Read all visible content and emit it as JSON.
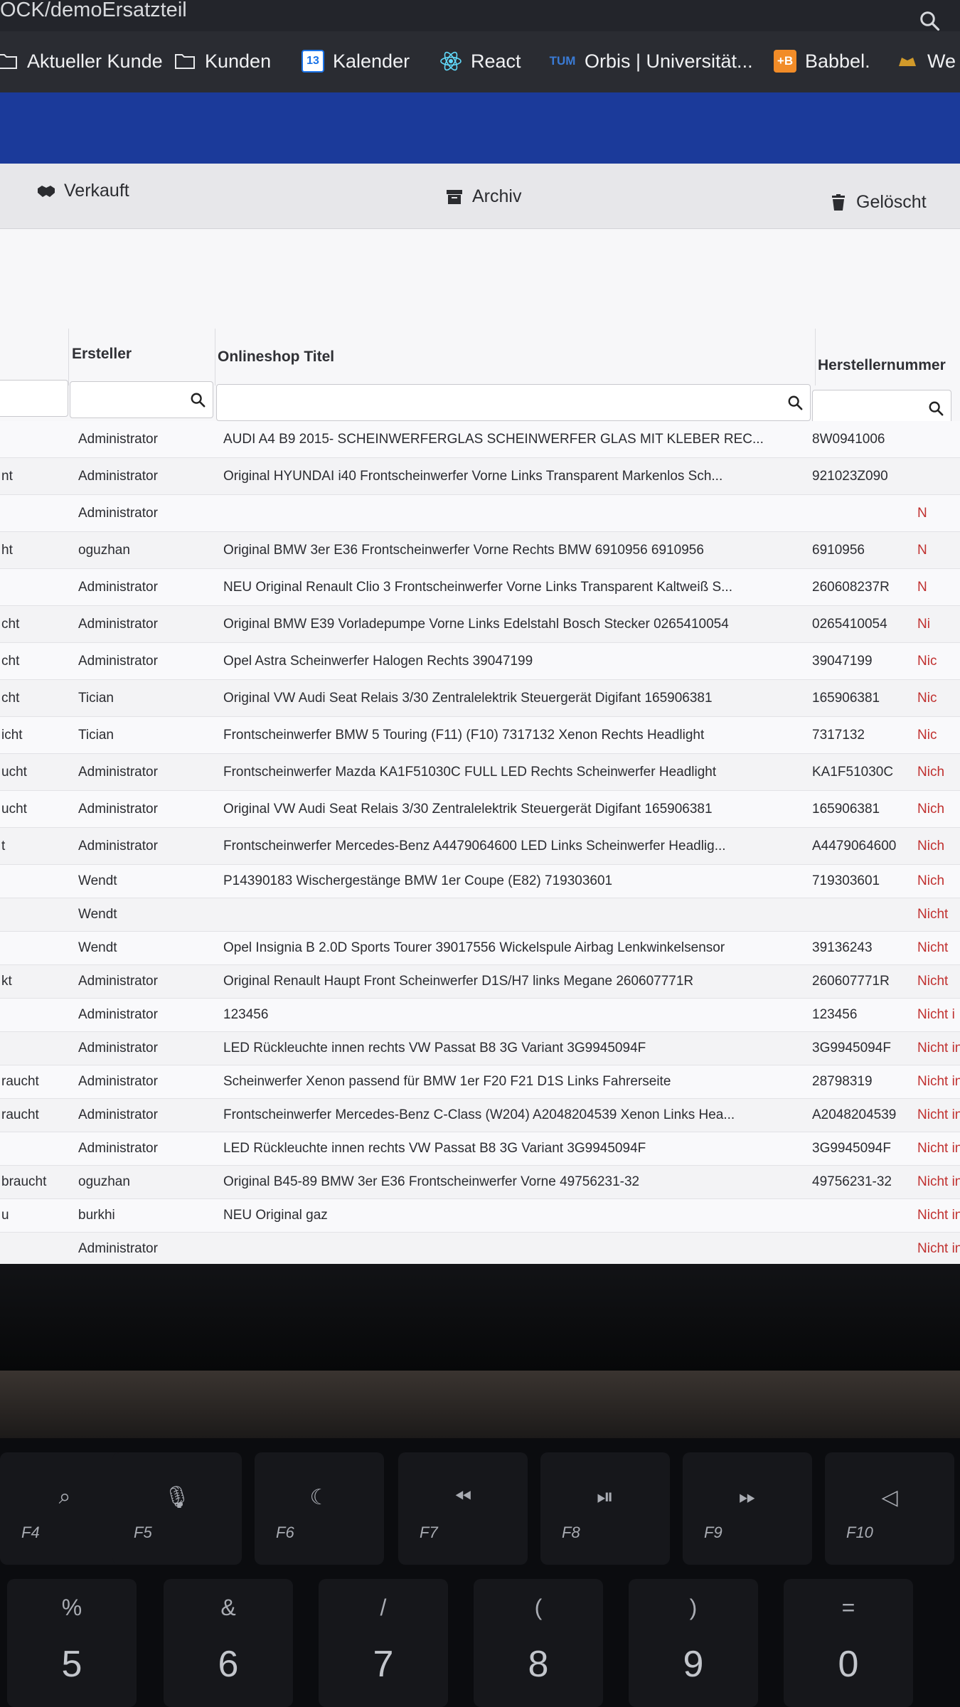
{
  "browser": {
    "url_fragment": "OCK/demoErsatzteil",
    "bookmarks": [
      {
        "label": "Aktueller Kunde",
        "icon": "folder-icon"
      },
      {
        "label": "Kunden",
        "icon": "folder-icon"
      },
      {
        "label": "Kalender",
        "icon": "calendar-icon",
        "icon_text": "13"
      },
      {
        "label": "React",
        "icon": "react-icon"
      },
      {
        "label": "Orbis | Universität...",
        "icon": "tum-icon",
        "icon_text": "TUM"
      },
      {
        "label": "Babbel.",
        "icon": "babbel-icon",
        "icon_text": "+B"
      },
      {
        "label": "We",
        "icon": "hat-icon"
      }
    ]
  },
  "tabs": [
    {
      "label": "Verkauft",
      "icon": "handshake-icon"
    },
    {
      "label": "Archiv",
      "icon": "archive-icon"
    },
    {
      "label": "Gelöscht",
      "icon": "trash-icon"
    }
  ],
  "table": {
    "headers": {
      "creator": "Ersteller",
      "title": "Onlineshop Titel",
      "number": "Herstellernummer"
    },
    "rows": [
      {
        "status": "",
        "creator": "Administrator",
        "title": "AUDI A4 B9 2015- SCHEINWERFERGLAS SCHEINWERFER GLAS MIT KLEBER REC...",
        "number": "8W0941006",
        "shop": ""
      },
      {
        "status": "nt",
        "creator": "Administrator",
        "title": "Original HYUNDAI i40 Frontscheinwerfer Vorne Links Transparent Markenlos Sch...",
        "number": "921023Z090",
        "shop": ""
      },
      {
        "status": "",
        "creator": "Administrator",
        "title": "",
        "number": "",
        "shop": "N"
      },
      {
        "status": "ht",
        "creator": "oguzhan",
        "title": "Original BMW 3er E36 Frontscheinwerfer Vorne Rechts BMW 6910956 6910956",
        "number": "6910956",
        "shop": "N"
      },
      {
        "status": "",
        "creator": "Administrator",
        "title": "NEU Original Renault Clio 3 Frontscheinwerfer Vorne Links Transparent Kaltweiß S...",
        "number": "260608237R",
        "shop": "N"
      },
      {
        "status": "cht",
        "creator": "Administrator",
        "title": "Original BMW E39 Vorladepumpe Vorne Links Edelstahl Bosch Stecker 0265410054",
        "number": "0265410054",
        "shop": "Ni"
      },
      {
        "status": "cht",
        "creator": "Administrator",
        "title": "Opel Astra Scheinwerfer Halogen Rechts 39047199",
        "number": "39047199",
        "shop": "Nic"
      },
      {
        "status": "cht",
        "creator": "Tician",
        "title": "Original VW Audi Seat Relais 3/30 Zentralelektrik Steuergerät Digifant 165906381",
        "number": "165906381",
        "shop": "Nic"
      },
      {
        "status": "icht",
        "creator": "Tician",
        "title": "Frontscheinwerfer BMW 5 Touring (F11) (F10) 7317132 Xenon Rechts Headlight",
        "number": "7317132",
        "shop": "Nic"
      },
      {
        "status": "ucht",
        "creator": "Administrator",
        "title": "Frontscheinwerfer Mazda KA1F51030C FULL LED Rechts Scheinwerfer Headlight",
        "number": "KA1F51030C",
        "shop": "Nich"
      },
      {
        "status": "ucht",
        "creator": "Administrator",
        "title": "Original VW Audi Seat Relais 3/30 Zentralelektrik Steuergerät Digifant 165906381",
        "number": "165906381",
        "shop": "Nich"
      },
      {
        "status": "t",
        "creator": "Administrator",
        "title": "Frontscheinwerfer Mercedes-Benz A4479064600 LED Links Scheinwerfer Headlig...",
        "number": "A4479064600",
        "shop": "Nich"
      },
      {
        "status": "",
        "creator": "Wendt",
        "title": "P14390183 Wischergestänge BMW 1er Coupe (E82) 719303601",
        "number": "719303601",
        "shop": "Nich"
      },
      {
        "status": "",
        "creator": "Wendt",
        "title": "",
        "number": "",
        "shop": "Nicht"
      },
      {
        "status": "",
        "creator": "Wendt",
        "title": "Opel Insignia B 2.0D Sports Tourer 39017556 Wickelspule Airbag Lenkwinkelsensor",
        "number": "39136243",
        "shop": "Nicht"
      },
      {
        "status": "kt",
        "creator": "Administrator",
        "title": "Original Renault Haupt Front Scheinwerfer D1S/H7 links Megane 260607771R",
        "number": "260607771R",
        "shop": "Nicht"
      },
      {
        "status": "",
        "creator": "Administrator",
        "title": "123456",
        "number": "123456",
        "shop": "Nicht i"
      },
      {
        "status": "",
        "creator": "Administrator",
        "title": "LED Rückleuchte innen rechts VW Passat B8 3G Variant 3G9945094F",
        "number": "3G9945094F",
        "shop": "Nicht in"
      },
      {
        "status": "raucht",
        "creator": "Administrator",
        "title": "Scheinwerfer Xenon passend für BMW 1er F20 F21 D1S Links Fahrerseite",
        "number": "28798319",
        "shop": "Nicht in"
      },
      {
        "status": "raucht",
        "creator": "Administrator",
        "title": "Frontscheinwerfer Mercedes-Benz C-Class (W204) A2048204539 Xenon Links Hea...",
        "number": "A2048204539",
        "shop": "Nicht in"
      },
      {
        "status": "",
        "creator": "Administrator",
        "title": "LED Rückleuchte innen rechts VW Passat B8 3G Variant 3G9945094F",
        "number": "3G9945094F",
        "shop": "Nicht in"
      },
      {
        "status": "braucht",
        "creator": "oguzhan",
        "title": "Original B45-89 BMW 3er E36 Frontscheinwerfer Vorne 49756231-32",
        "number": "49756231-32",
        "shop": "Nicht ins"
      },
      {
        "status": "u",
        "creator": "burkhi",
        "title": "NEU Original gaz",
        "number": "",
        "shop": "Nicht ins"
      },
      {
        "status": "",
        "creator": "Administrator",
        "title": "",
        "number": "",
        "shop": "Nicht ins"
      }
    ]
  },
  "keyboard": {
    "function_keys": [
      {
        "label": "F4",
        "glyph": "search-icon"
      },
      {
        "label": "F5",
        "glyph": "mic-icon"
      },
      {
        "label": "F6",
        "glyph": "moon-icon"
      },
      {
        "label": "F7",
        "glyph": "rewind-icon"
      },
      {
        "label": "F8",
        "glyph": "play-pause-icon"
      },
      {
        "label": "F9",
        "glyph": "fast-forward-icon"
      },
      {
        "label": "F10",
        "glyph": "mute-icon"
      }
    ],
    "number_keys": [
      {
        "symbol": "%",
        "number": "5"
      },
      {
        "symbol": "&",
        "number": "6"
      },
      {
        "symbol": "/",
        "number": "7"
      },
      {
        "symbol": "(",
        "number": "8"
      },
      {
        "symbol": ")",
        "number": "9"
      },
      {
        "symbol": "=",
        "number": "0"
      }
    ]
  }
}
